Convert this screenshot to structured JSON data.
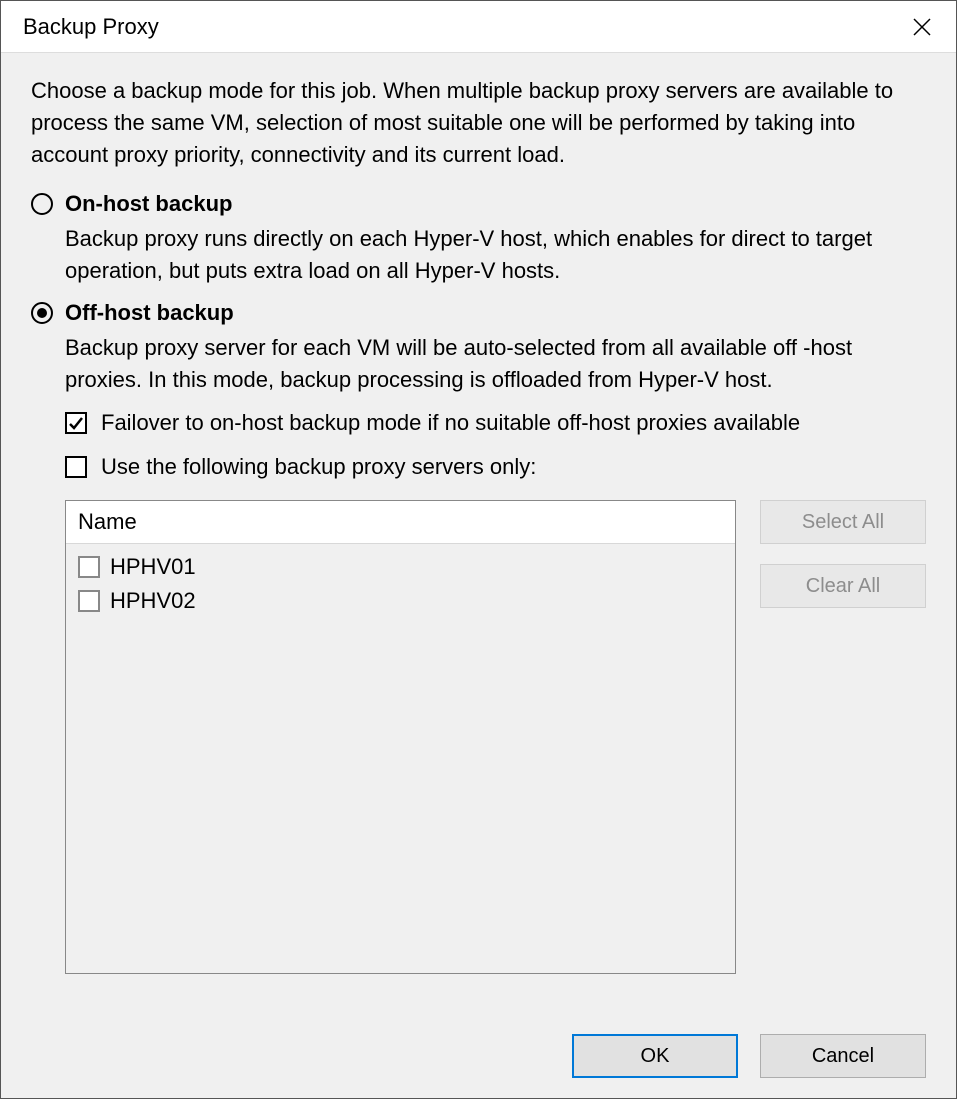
{
  "window": {
    "title": "Backup Proxy"
  },
  "intro": "Choose a backup mode for this job. When multiple backup proxy servers are available to process the same VM, selection of most suitable one will be performed by taking into account proxy priority, connectivity and its current load.",
  "modes": {
    "onhost": {
      "label": "On-host backup",
      "desc": "Backup proxy runs directly on each Hyper-V host, which enables for direct to target operation, but puts extra load on all Hyper-V hosts.",
      "selected": false
    },
    "offhost": {
      "label": "Off-host backup",
      "desc": "Backup proxy server for each VM will be auto-selected from all available off -host proxies. In this mode, backup processing is offloaded from Hyper-V host.",
      "selected": true
    }
  },
  "options": {
    "failover": {
      "label": "Failover to on-host backup mode if no suitable off-host proxies available",
      "checked": true
    },
    "use_only": {
      "label": "Use the following backup proxy servers only:",
      "checked": false
    }
  },
  "proxy_list": {
    "header": "Name",
    "items": [
      {
        "name": "HPHV01",
        "checked": false
      },
      {
        "name": "HPHV02",
        "checked": false
      }
    ]
  },
  "buttons": {
    "select_all": "Select All",
    "clear_all": "Clear All",
    "ok": "OK",
    "cancel": "Cancel"
  }
}
